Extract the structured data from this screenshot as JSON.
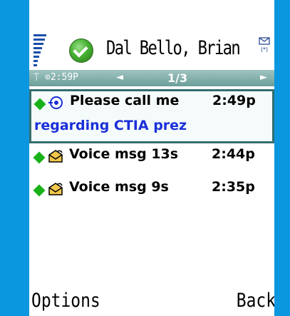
{
  "header": {
    "contact_name": "Dal Bello, Brian",
    "presence_icon": "green-check-presence-icon",
    "message_indicator_icon": "envelope-bluetooth-icon"
  },
  "tabbar": {
    "clock": "2:59P",
    "page": "1/3",
    "left_arrow": "◄",
    "right_arrow": "►",
    "tower": "⍑"
  },
  "messages": [
    {
      "title": "Please call me",
      "time": "2:49p",
      "subtext": "regarding CTIA prez",
      "icon": "callback-icon",
      "selected": true
    },
    {
      "title": "Voice msg 13s",
      "time": "2:44p",
      "icon": "voice-envelope-icon",
      "selected": false
    },
    {
      "title": "Voice msg 9s",
      "time": "2:35p",
      "icon": "voice-envelope-icon",
      "selected": false
    }
  ],
  "softkeys": {
    "left": "Options",
    "right": "Back"
  },
  "colors": {
    "frame": "#0b97e0",
    "tabbar": "#6d9e99",
    "selection_border": "#336e70",
    "subtext": "#1a2fd8",
    "status_diamond": "#18b218"
  }
}
